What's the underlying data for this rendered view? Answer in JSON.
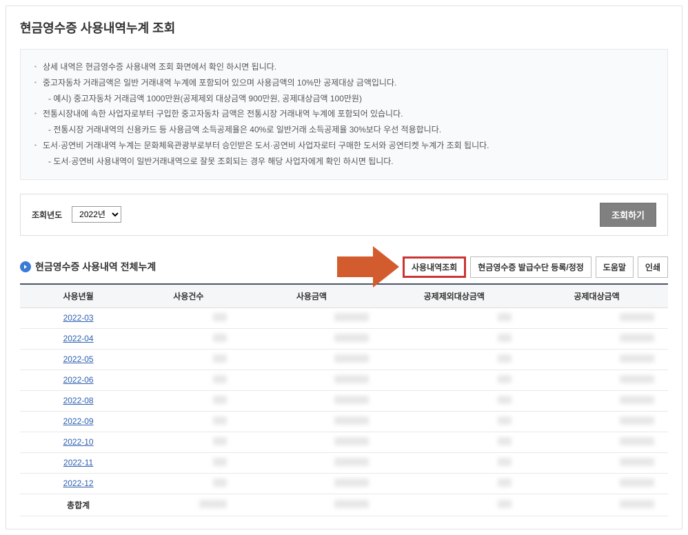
{
  "page": {
    "title": "현금영수증 사용내역누계 조회"
  },
  "info": {
    "items": [
      {
        "text": "상세 내역은 현금영수증 사용내역 조회 화면에서 확인 하시면 됩니다.",
        "bullet": true
      },
      {
        "text": "중고자동차 거래금액은 일반 거래내역 누계에 포함되어 있으며 사용금액의 10%만 공제대상 금액입니다.",
        "bullet": true
      },
      {
        "text": "- 예시) 중고자동차 거래금액 1000만원(공제제외 대상금액 900만원, 공제대상금액 100만원)",
        "bullet": false
      },
      {
        "text": "전통시장내에 속한 사업자로부터 구입한 중고자동차 금액은 전통시장 거래내역 누계에 포함되어 있습니다.",
        "bullet": true
      },
      {
        "text": "- 전통시장 거래내역의 신용카드 등 사용금액 소득공제율은 40%로 일반거래 소득공제율 30%보다 우선 적용합니다.",
        "bullet": false
      },
      {
        "text": "도서·공연비 거래내역 누계는 문화체육관광부로부터 승인받은 도서·공연비 사업자로터 구매한 도서와 공연티켓 누계가 조회 됩니다.",
        "bullet": true
      },
      {
        "text": "- 도서·공연비 사용내역이 일반거래내역으로 잘못 조회되는 경우 해당 사업자에게 확인 하시면 됩니다.",
        "bullet": false
      }
    ]
  },
  "search": {
    "year_label": "조회년도",
    "year_value": "2022년",
    "submit_label": "조회하기"
  },
  "section": {
    "title": "현금영수증 사용내역 전체누계",
    "actions": {
      "detail": "사용내역조회",
      "issue": "현금영수증 발급수단 등록/정정",
      "help": "도움말",
      "print": "인쇄"
    }
  },
  "table": {
    "headers": {
      "month": "사용년월",
      "count": "사용건수",
      "amount": "사용금액",
      "excluded": "공제제외대상금액",
      "deductible": "공제대상금액"
    },
    "rows": [
      {
        "month": "2022-03"
      },
      {
        "month": "2022-04"
      },
      {
        "month": "2022-05"
      },
      {
        "month": "2022-06"
      },
      {
        "month": "2022-08"
      },
      {
        "month": "2022-09"
      },
      {
        "month": "2022-10"
      },
      {
        "month": "2022-11"
      },
      {
        "month": "2022-12"
      }
    ],
    "total_label": "총합계"
  }
}
